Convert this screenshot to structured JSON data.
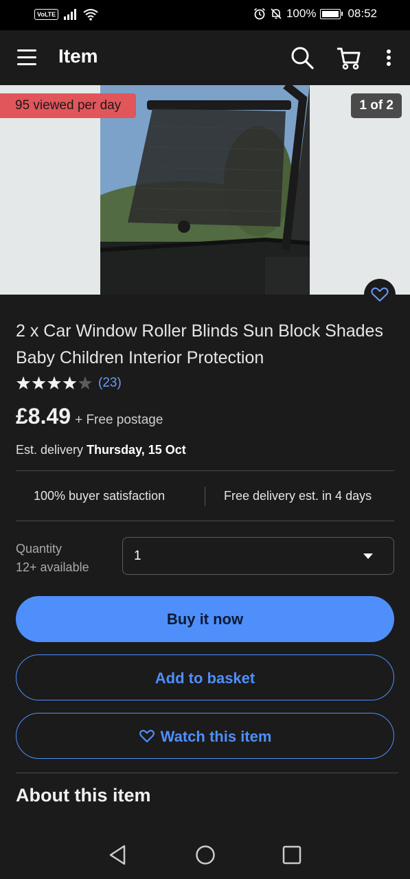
{
  "status_bar": {
    "volte": "VoLTE",
    "battery": "100%",
    "time": "08:52"
  },
  "appbar": {
    "title": "Item",
    "icons": [
      "menu-icon",
      "search-icon",
      "cart-icon",
      "more-vert-icon"
    ]
  },
  "gallery": {
    "viewed_badge": "95 viewed per day",
    "counter": "1 of 2"
  },
  "product": {
    "title": "2 x Car Window Roller Blinds Sun Block Shades Baby Children Interior Protection",
    "rating_stars": 4,
    "rating_max": 5,
    "rating_count": "(23)",
    "price": "£8.49",
    "postage": "+ Free postage",
    "delivery_prefix": "Est. delivery",
    "delivery_date": "Thursday, 15 Oct"
  },
  "stats": {
    "satisfaction": "100% buyer satisfaction",
    "free_delivery": "Free delivery est. in 4 days"
  },
  "quantity": {
    "label": "Quantity",
    "available": "12+ available",
    "value": "1"
  },
  "buttons": {
    "buy_now": "Buy it now",
    "add_to_basket": "Add to basket",
    "watch": "Watch this item"
  },
  "about": {
    "heading": "About this item"
  },
  "colors": {
    "accent": "#4f8ffb",
    "badge": "#e0565b",
    "background": "#1b1b1c"
  }
}
